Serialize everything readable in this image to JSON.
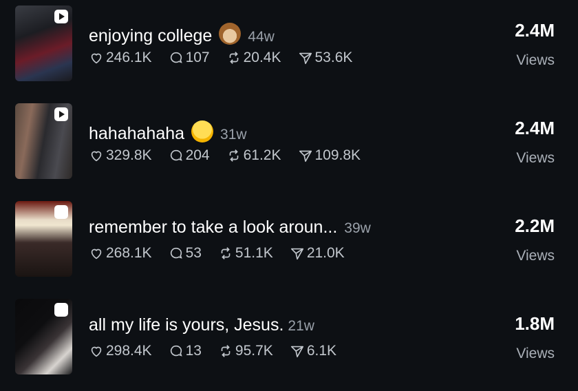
{
  "posts": [
    {
      "title": "enjoying college",
      "emoji": "see-no-evil-monkey-emoji",
      "age": "44w",
      "likes": "246.1K",
      "comments": "107",
      "reposts": "20.4K",
      "shares": "53.6K",
      "views": "2.4M",
      "views_label": "Views"
    },
    {
      "title": "hahahahaha",
      "emoji": "tongue-out-face-emoji",
      "age": "31w",
      "likes": "329.8K",
      "comments": "204",
      "reposts": "61.2K",
      "shares": "109.8K",
      "views": "2.4M",
      "views_label": "Views"
    },
    {
      "title": "remember to take a look aroun...",
      "age": "39w",
      "likes": "268.1K",
      "comments": "53",
      "reposts": "51.1K",
      "shares": "21.0K",
      "views": "2.2M",
      "views_label": "Views"
    },
    {
      "title": "all my life is yours, Jesus.",
      "age": "21w",
      "likes": "298.4K",
      "comments": "13",
      "reposts": "95.7K",
      "shares": "6.1K",
      "views": "1.8M",
      "views_label": "Views"
    }
  ],
  "icons": {
    "like": "heart-icon",
    "comment": "comment-bubble-icon",
    "repost": "repost-icon",
    "share": "share-arrow-icon"
  },
  "colors": {
    "background": "#0d1014",
    "primary_text": "#ffffff",
    "secondary_text": "#9aa1aa"
  }
}
